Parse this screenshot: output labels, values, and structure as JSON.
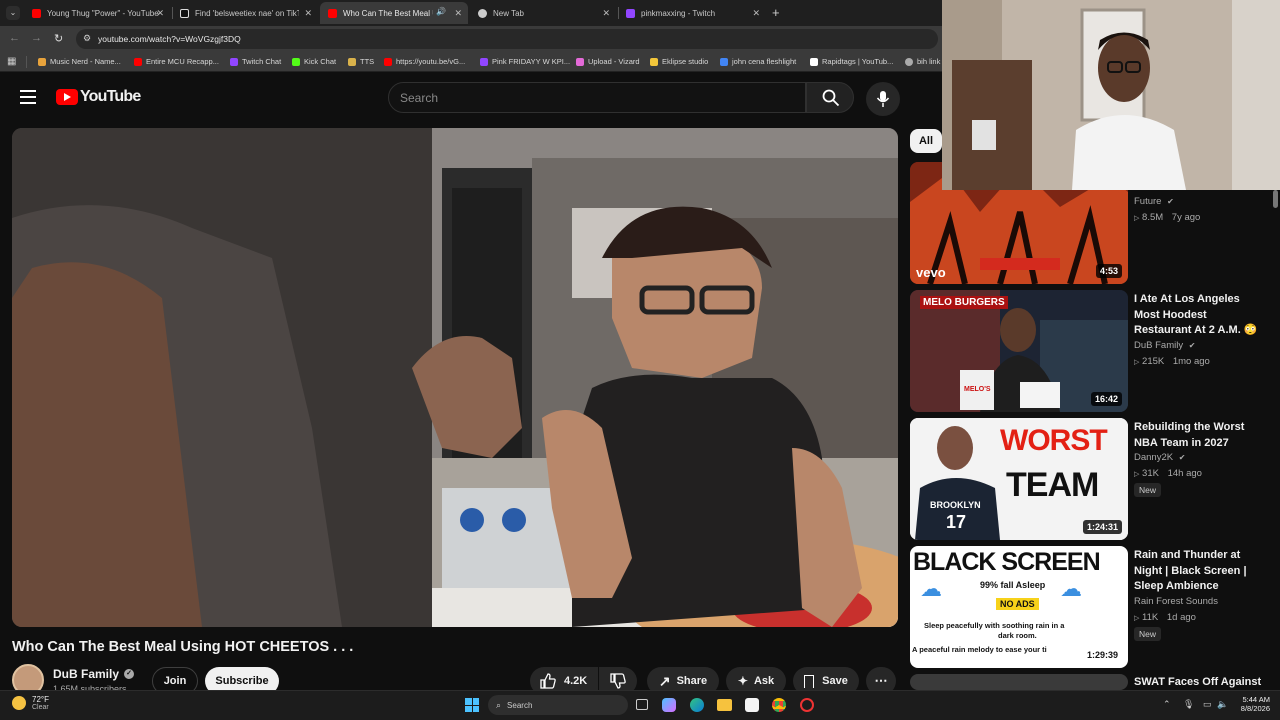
{
  "browser": {
    "tabs": [
      {
        "label": "Young Thug \"Power\" - YouTube",
        "icon": "youtube-icon",
        "color": "#ff0000"
      },
      {
        "label": "Find 'belsweetiex nae' on TikTok",
        "icon": "tiktok-icon",
        "color": "#ffffff"
      },
      {
        "label": "Who Can The Best Meal Us",
        "icon": "youtube-icon",
        "color": "#ff0000"
      },
      {
        "label": "New Tab",
        "icon": "chrome-icon",
        "color": "#cccccc"
      },
      {
        "label": "pinkmaxxing - Twitch",
        "icon": "twitch-icon",
        "color": "#9146ff"
      }
    ],
    "new_tab": "+",
    "url": "youtube.com/watch?v=WoVGzgjf3DQ",
    "bookmarks": [
      {
        "label": "Music Nerd - Name...",
        "color": "#e8a33c"
      },
      {
        "label": "Entire MCU Recapp...",
        "color": "#ff0000"
      },
      {
        "label": "Twitch Chat",
        "color": "#9146ff"
      },
      {
        "label": "Kick Chat",
        "color": "#53fc18"
      },
      {
        "label": "TTS",
        "color": "#d9b24b"
      },
      {
        "label": "https://youtu.be/vG...",
        "color": "#ff0000"
      },
      {
        "label": "Pink FRIDAYY W KPI...",
        "color": "#9146ff"
      },
      {
        "label": "Upload - Vizard",
        "color": "#e46ad8"
      },
      {
        "label": "Eklipse studio",
        "color": "#f2c63a"
      },
      {
        "label": "john cena fleshlight",
        "color": "#4285f4"
      },
      {
        "label": "Rapidtags | YouTub...",
        "color": "#ffffff"
      },
      {
        "label": "bih link",
        "color": "#aaaaaa"
      }
    ]
  },
  "youtube": {
    "logo_text": "YouTube",
    "search_placeholder": "Search",
    "video": {
      "title": "Who Can The Best Meal Using HOT CHEETOS . . .",
      "channel": "DuB Family",
      "subscribers": "1.65M subscribers",
      "join_label": "Join",
      "subscribe_label": "Subscribe",
      "likes": "4.2K",
      "share_label": "Share",
      "ask_label": "Ask",
      "save_label": "Save"
    },
    "chips": {
      "all": "All"
    },
    "recommended": [
      {
        "title": "",
        "channel": "Future",
        "views": "8.5M",
        "age": "7y ago",
        "duration": "4:53",
        "badge": ""
      },
      {
        "title": "I Ate At Los Angeles Most Hoodest Restaurant At 2 A.M. 😳",
        "channel": "DuB Family",
        "views": "215K",
        "age": "1mo ago",
        "duration": "16:42",
        "badge": ""
      },
      {
        "title": "Rebuilding the Worst NBA Team in 2027",
        "channel": "Danny2K",
        "views": "31K",
        "age": "14h ago",
        "duration": "1:24:31",
        "badge": "New"
      },
      {
        "title": "Rain and Thunder at Night | Black Screen | Sleep Ambience",
        "channel": "Rain Forest Sounds",
        "views": "11K",
        "age": "1d ago",
        "duration": "1:29:39",
        "badge": "New"
      },
      {
        "title": "SWAT Faces Off Against",
        "channel": "",
        "views": "",
        "age": "",
        "duration": "",
        "badge": ""
      }
    ],
    "thumb_text": {
      "vevo": "vevo",
      "melo": "MELO BURGERS",
      "melos_bag": "MELO'S",
      "worst": "WORST",
      "team": "TEAM",
      "jersey_team": "BROOKLYN",
      "jersey_number": "17",
      "black_screen": "BLACK SCREEN",
      "asleep": "99% fall Asleep",
      "no_ads": "NO ADS",
      "sleep_line1": "Sleep peacefully with soothing rain in a",
      "sleep_line2": "dark room.",
      "sleep_line3": "A peaceful rain melody to ease your ti"
    }
  },
  "taskbar": {
    "weather_temp": "72°F",
    "weather_desc": "Clear",
    "search_label": "Search",
    "time": "5:44 AM",
    "date": "8/8/2026"
  }
}
